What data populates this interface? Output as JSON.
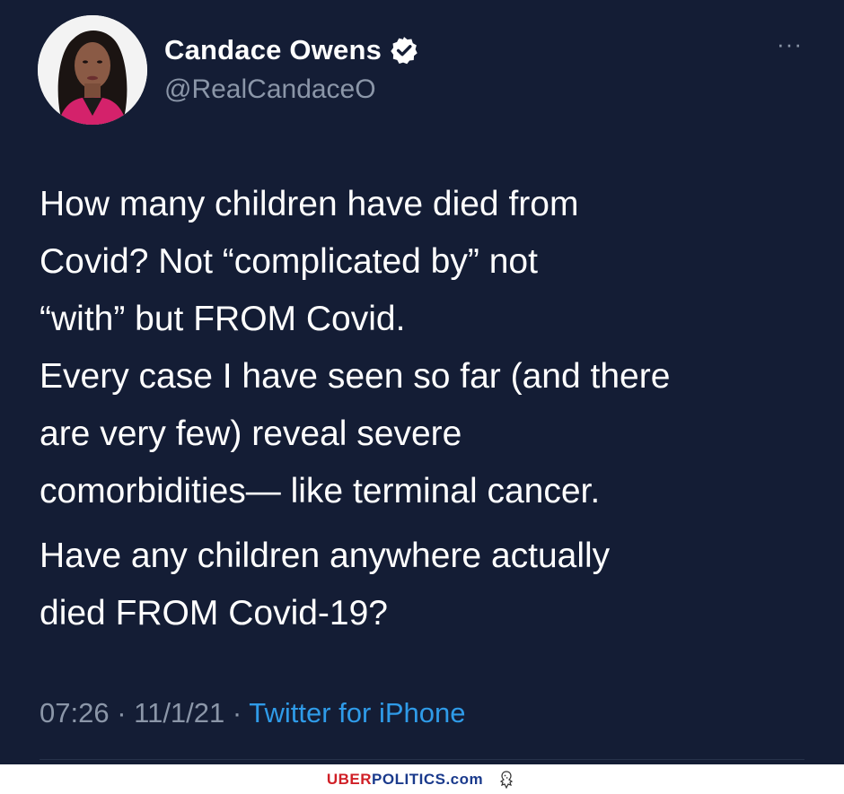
{
  "tweet": {
    "author_name": "Candace Owens",
    "author_handle": "@RealCandaceO",
    "more_label": "···",
    "paragraphs": [
      "How many children have died from\nCovid? Not “complicated by” not\n“with” but FROM Covid.\nEvery case I have seen so far (and there\nare very few) reveal severe\ncomorbidities— like terminal cancer.",
      "Have any children anywhere actually\ndied FROM Covid-19?"
    ],
    "time": "07:26",
    "date": "11/1/21",
    "separator": " · ",
    "source": "Twitter for iPhone"
  },
  "watermark": {
    "part1": "UBER",
    "part2": "POLITICS.com",
    "icon": "eagle-icon"
  },
  "colors": {
    "background": "#141d35",
    "secondary_text": "#8b96a8",
    "link": "#2f9be8",
    "brand_red": "#d01f26",
    "brand_blue": "#1a3a8c"
  }
}
